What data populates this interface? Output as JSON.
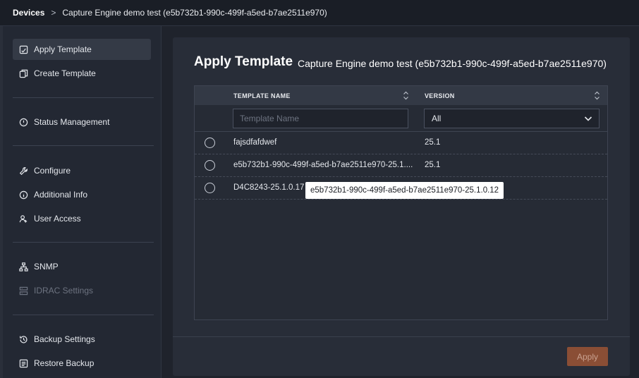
{
  "breadcrumb": {
    "root": "Devices",
    "separator": ">",
    "current": "Capture Engine demo test (e5b732b1-990c-499f-a5ed-b7ae2511e970)"
  },
  "sidebar": {
    "items": [
      {
        "label": "Apply Template",
        "icon": "apply-template-icon",
        "active": true
      },
      {
        "label": "Create Template",
        "icon": "create-template-icon"
      },
      {
        "label": "Status Management",
        "icon": "status-icon"
      },
      {
        "label": "Configure",
        "icon": "wrench-icon"
      },
      {
        "label": "Additional Info",
        "icon": "info-icon"
      },
      {
        "label": "User Access",
        "icon": "user-access-icon"
      },
      {
        "label": "SNMP",
        "icon": "network-icon"
      },
      {
        "label": "IDRAC Settings",
        "icon": "server-icon",
        "disabled": true
      },
      {
        "label": "Backup Settings",
        "icon": "history-icon"
      },
      {
        "label": "Restore Backup",
        "icon": "restore-icon"
      }
    ]
  },
  "panel": {
    "title": "Apply Template",
    "subtitle": "Capture Engine demo test (e5b732b1-990c-499f-a5ed-b7ae2511e970)"
  },
  "table": {
    "columns": [
      "TEMPLATE NAME",
      "VERSION"
    ],
    "filter": {
      "name_placeholder": "Template Name",
      "version_selected": "All"
    },
    "rows": [
      {
        "name": "fajsdfafdwef",
        "version": "25.1"
      },
      {
        "name": "e5b732b1-990c-499f-a5ed-b7ae2511e970-25.1....",
        "version": "25.1"
      },
      {
        "name": "D4C8243-25.1.0.17",
        "version": ""
      }
    ]
  },
  "tooltip": "e5b732b1-990c-499f-a5ed-b7ae2511e970-25.1.0.12",
  "footer": {
    "apply_label": "Apply"
  },
  "colors": {
    "accent": "#8a4e35",
    "background": "#1f232c",
    "panel": "#282d38"
  }
}
